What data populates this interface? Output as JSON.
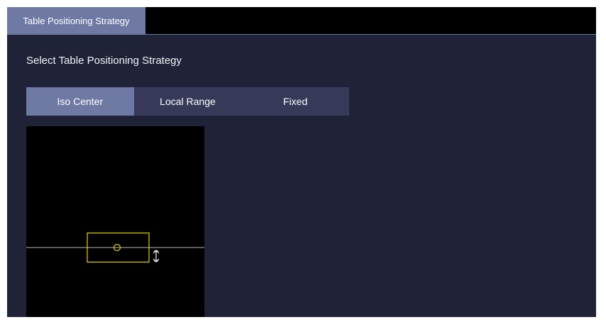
{
  "tabs": [
    {
      "label": "Table Positioning Strategy",
      "active": true
    }
  ],
  "heading": "Select Table Positioning Strategy",
  "strategy_options": [
    {
      "label": "Iso Center",
      "selected": true
    },
    {
      "label": "Local Range",
      "selected": false
    },
    {
      "label": "Fixed",
      "selected": false
    }
  ],
  "viewer": {
    "icons": [
      "table-outline",
      "iso-center-marker",
      "vertical-resize-icon"
    ]
  },
  "colors": {
    "background": "#202238",
    "tab_active": "#6e7aa3",
    "segment_bg": "#363a58",
    "segment_active": "#6e7aa3",
    "viewer_bg": "#000000",
    "table_outline": "#e8d400",
    "table_line": "#b8b8b8"
  }
}
